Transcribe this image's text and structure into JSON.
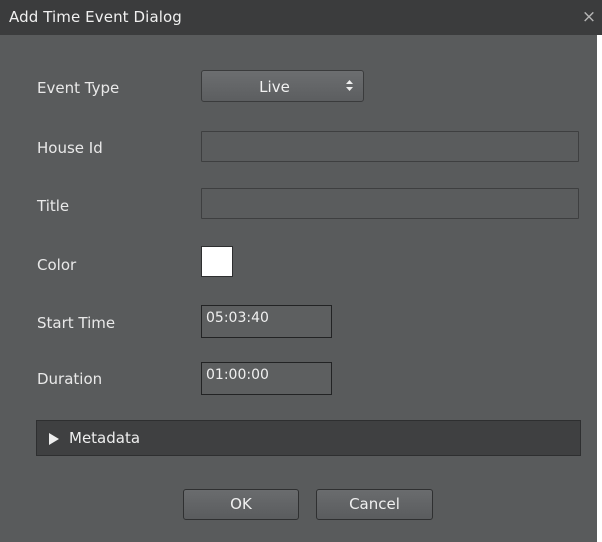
{
  "dialog": {
    "title": "Add Time Event Dialog",
    "close_glyph": "×"
  },
  "form": {
    "event_type_label": "Event Type",
    "event_type_value": "Live",
    "house_id_label": "House Id",
    "house_id_value": "",
    "title_label": "Title",
    "title_value": "",
    "color_label": "Color",
    "color_value": "#ffffff",
    "start_time_label": "Start Time",
    "start_time_value": "05:03:40",
    "duration_label": "Duration",
    "duration_value": "01:00:00"
  },
  "metadata": {
    "label": "Metadata",
    "expanded": false
  },
  "buttons": {
    "ok_label": "OK",
    "cancel_label": "Cancel"
  }
}
